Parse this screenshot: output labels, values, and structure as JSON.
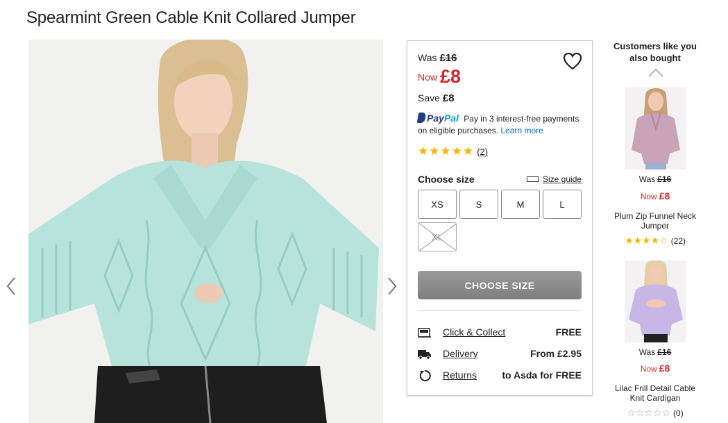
{
  "product": {
    "title": "Spearmint Green Cable Knit Collared Jumper",
    "image_alt": "Woman wearing mint green cable knit collared jumper and black leather skirt"
  },
  "pricing": {
    "was_label": "Was",
    "was_price": "£16",
    "now_label": "Now",
    "now_price": "£8",
    "save_label": "Save",
    "save_amount": "£8",
    "accent_color": "#d6272f"
  },
  "paypal": {
    "logo_main": "Pay",
    "logo_accent": "Pal",
    "text": "Pay in 3 interest-free payments on eligible purchases.",
    "link": "Learn more"
  },
  "rating": {
    "stars": "★★★★★",
    "value": 5,
    "count": "(2)"
  },
  "size_picker": {
    "label": "Choose size",
    "guide_label": "Size guide",
    "sizes": [
      {
        "label": "XS",
        "available": true
      },
      {
        "label": "S",
        "available": true
      },
      {
        "label": "M",
        "available": true
      },
      {
        "label": "L",
        "available": true
      },
      {
        "label": "XL",
        "available": false
      }
    ],
    "cta": "CHOOSE SIZE"
  },
  "delivery": [
    {
      "icon": "store-icon",
      "label": "Click & Collect",
      "value": "FREE"
    },
    {
      "icon": "truck-icon",
      "label": "Delivery",
      "value": "From £2.95"
    },
    {
      "icon": "return-icon",
      "label": "Returns",
      "value": "to Asda for FREE"
    }
  ],
  "recommendations": {
    "title": "Customers like you also bought",
    "items": [
      {
        "was_label": "Was",
        "was_price": "£16",
        "now_label": "Now",
        "now_price": "£8",
        "name": "Plum Zip Funnel Neck Jumper",
        "stars": "★★★★☆",
        "rating": 4,
        "count": "(22)",
        "color": "#c9a3b8"
      },
      {
        "was_label": "Was",
        "was_price": "£16",
        "now_label": "Now",
        "now_price": "£8",
        "name": "Lilac Frill Detail Cable Knit Cardigan",
        "stars": "☆☆☆☆☆",
        "rating": 0,
        "count": "(0)",
        "color": "#c8b6e6"
      }
    ]
  }
}
